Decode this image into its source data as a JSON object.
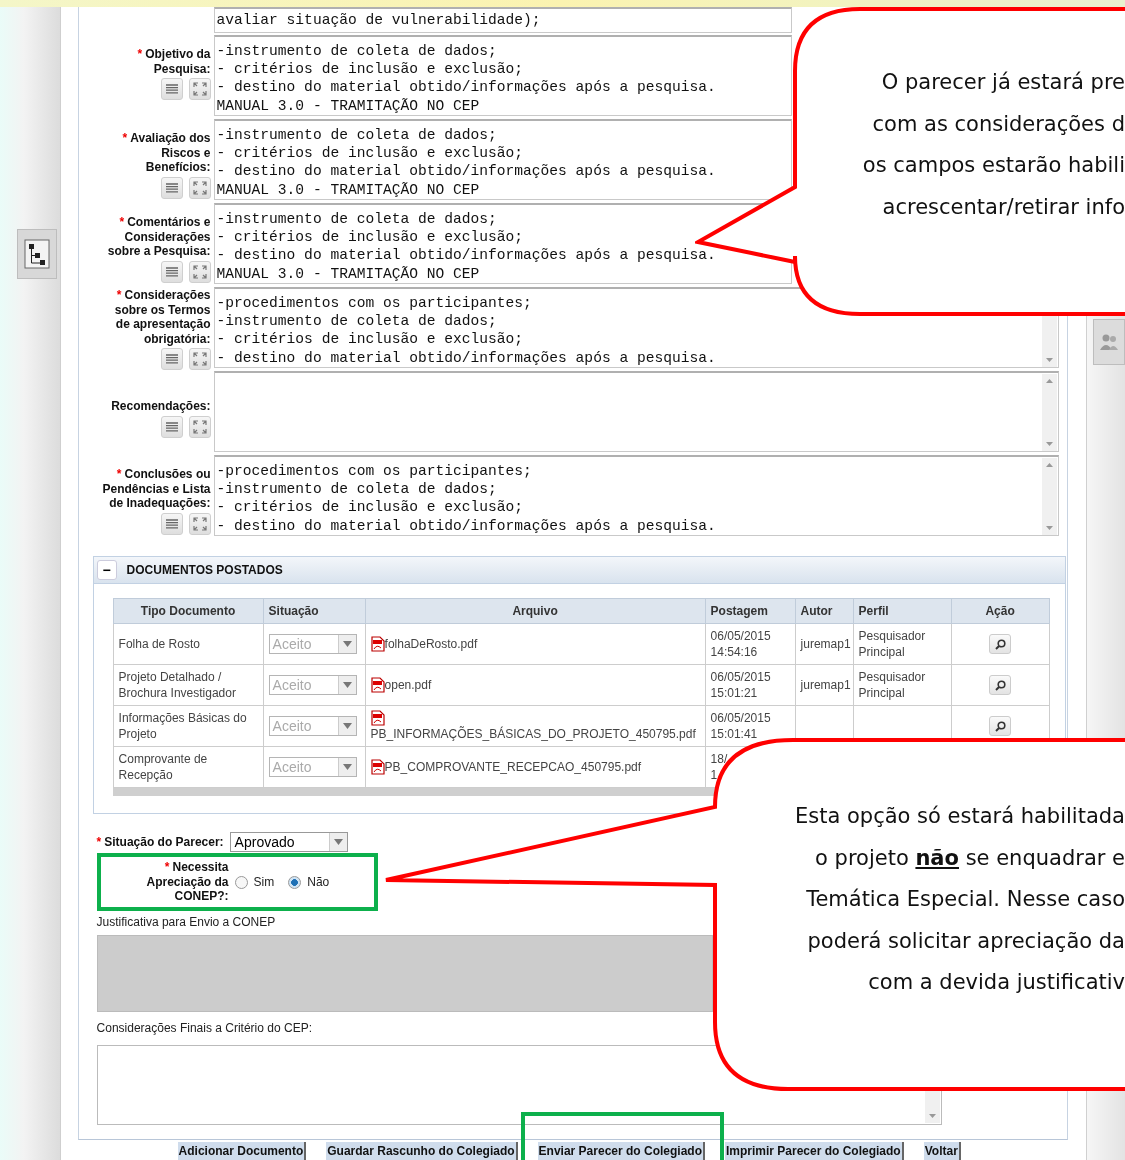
{
  "top_field": {
    "lines": [
      "avaliar situação de vulnerabilidade);"
    ]
  },
  "fields": [
    {
      "asterisk": "*",
      "label": [
        "Objetivo da",
        "Pesquisa:"
      ],
      "scrollable": false,
      "lines": [
        "-instrumento de coleta de dados;",
        "- critérios de inclusão e exclusão;",
        "- destino do material obtido/informações após a pesquisa.",
        "MANUAL 3.0 - TRAMITAÇÃO NO CEP"
      ]
    },
    {
      "asterisk": "*",
      "label": [
        "Avaliação dos",
        "Riscos e",
        "Benefícios:"
      ],
      "scrollable": false,
      "lines": [
        "-instrumento de coleta de dados;",
        "- critérios de inclusão e exclusão;",
        "- destino do material obtido/informações após a pesquisa.",
        "MANUAL 3.0 - TRAMITAÇÃO NO CEP"
      ]
    },
    {
      "asterisk": "*",
      "label": [
        "Comentários e",
        "Considerações",
        "sobre a Pesquisa:"
      ],
      "scrollable": false,
      "lines": [
        "-instrumento de coleta de dados;",
        "- critérios de inclusão e exclusão;",
        "- destino do material obtido/informações após a pesquisa.",
        "MANUAL 3.0 - TRAMITAÇÃO NO CEP"
      ]
    },
    {
      "asterisk": "*",
      "label": [
        "Considerações",
        "sobre os Termos",
        "de apresentação",
        "obrigatória:"
      ],
      "scrollable": true,
      "lines": [
        "-procedimentos com os participantes;",
        "-instrumento de coleta de dados;",
        "- critérios de inclusão e exclusão;",
        "- destino do material obtido/informações após a pesquisa."
      ]
    },
    {
      "label": [
        "Recomendações:"
      ],
      "scrollable": true
    },
    {
      "asterisk": "*",
      "label": [
        "Conclusões ou",
        "Pendências e Lista",
        "de Inadequações:"
      ],
      "scrollable": true,
      "lines": [
        "-procedimentos com os participantes;",
        "-instrumento de coleta de dados;",
        "- critérios de inclusão e exclusão;",
        "- destino do material obtido/informações após a pesquisa."
      ]
    }
  ],
  "documents": {
    "toggle": "−",
    "title": "DOCUMENTOS POSTADOS",
    "expanded": true,
    "columns": [
      "Tipo Documento",
      "Situação",
      "Arquivo",
      "Postagem",
      "Autor",
      "Perfil",
      "Ação"
    ],
    "rows": [
      {
        "tipo": "Folha de Rosto",
        "situacao": "Aceito",
        "disabled": true,
        "arquivo": "folhaDeRosto.pdf",
        "postagem": [
          "06/05/2015",
          "14:54:16"
        ],
        "autor": "juremap1",
        "perfil": "Pesquisador Principal",
        "action": true
      },
      {
        "tipo": "Projeto Detalhado / Brochura Investigador",
        "situacao": "Aceito",
        "disabled": true,
        "arquivo": "open.pdf",
        "postagem": [
          "06/05/2015",
          "15:01:21"
        ],
        "autor": "juremap1",
        "perfil": "Pesquisador Principal",
        "action": true
      },
      {
        "tipo": "Informações Básicas do Projeto",
        "situacao": "Aceito",
        "disabled": true,
        "arquivo": "PB_INFORMAÇÕES_BÁSICAS_DO_PROJETO_450795.pdf",
        "postagem": [
          "06/05/2015",
          "15:01:41"
        ],
        "action": true
      },
      {
        "tipo": "Comprovante de Recepção",
        "situacao": "Aceito",
        "disabled": true,
        "arquivo": "PB_COMPROVANTE_RECEPCAO_450795.pdf",
        "postagem": [
          "18/",
          "1"
        ],
        "action": false
      }
    ]
  },
  "parecer": {
    "asterisk": "*",
    "label": "Situação do Parecer:",
    "value": "Aprovado"
  },
  "conep": {
    "asterisk": "*",
    "label": [
      "Necessita",
      "Apreciação da",
      "CONEP?:"
    ],
    "options": [
      {
        "label": "Sim",
        "selected": false
      },
      {
        "label": "Não",
        "selected": true
      }
    ]
  },
  "justificativa": {
    "label": "Justificativa para Envio a CONEP",
    "disabled": true
  },
  "consideracoes_finais": {
    "label": "Considerações Finais a Critério do CEP:"
  },
  "buttons": [
    "Adicionar Documento",
    "Guardar Rascunho do Colegiado",
    "Enviar Parecer do Colegiado",
    "Imprimir Parecer do Colegiado",
    "Voltar"
  ],
  "callouts": [
    {
      "lines": [
        "O parecer já estará pre",
        "com as considerações d",
        "os campos estarão habili",
        "acrescentar/retirar info"
      ]
    },
    {
      "lines": [
        "Esta opção só estará habilitada",
        "o projeto **não** se enquadrar e",
        "Temática Especial. Nesse caso",
        "poderá solicitar apreciação da",
        "com a devida justificativ"
      ]
    }
  ]
}
